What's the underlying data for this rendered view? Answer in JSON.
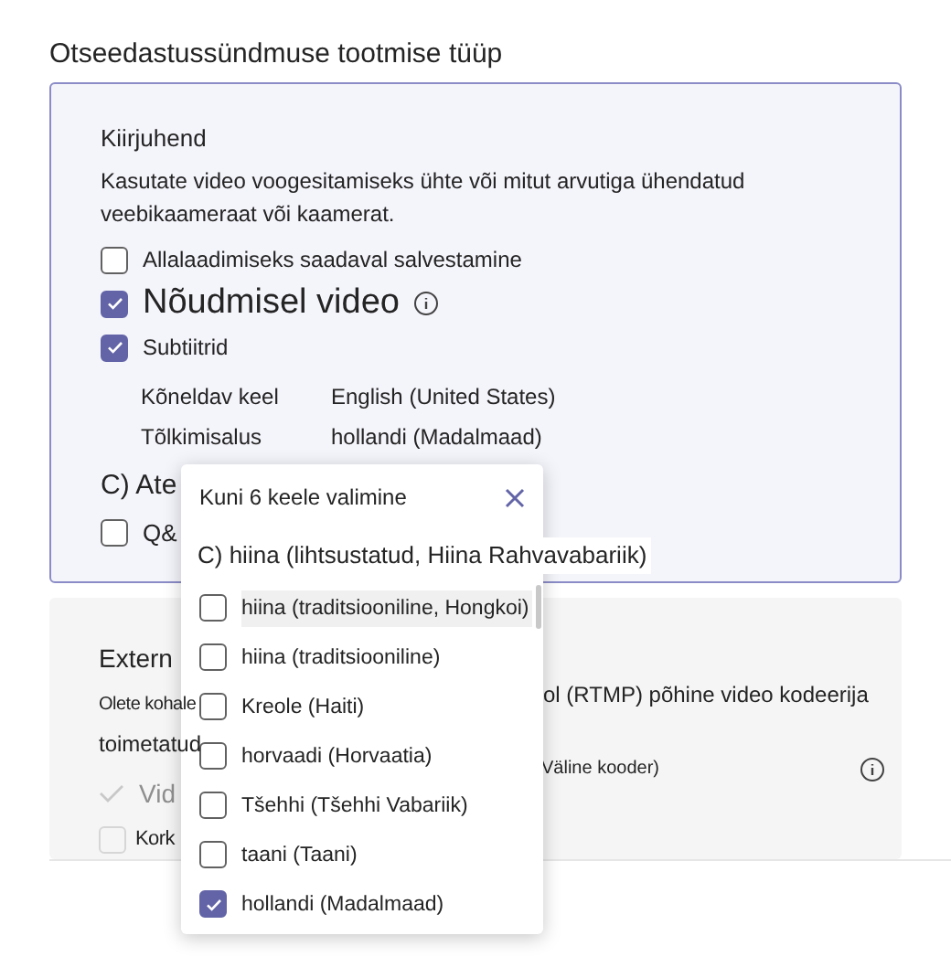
{
  "title": "Otseedastussündmuse tootmise tüüp",
  "quick_panel": {
    "heading": "Kiirjuhend",
    "description": "Kasutate video voogesitamiseks ühte või mitut arvutiga ühendatud veebikaameraat või kaamerat.",
    "options": [
      {
        "label": "Allalaadimiseks saadaval salvestamine",
        "checked": false,
        "large": false,
        "info": false
      },
      {
        "label": "Nõudmisel video",
        "checked": true,
        "large": true,
        "info": true
      },
      {
        "label": "Subtiitrid",
        "checked": true,
        "large": false,
        "info": false
      }
    ],
    "settings": [
      {
        "label": "Kõneldav keel",
        "value": "English (United States)"
      },
      {
        "label": "Tõlkimisalus",
        "value": "hollandi (Madalmaad)"
      }
    ],
    "section_label": "C) Ate",
    "extra_option": {
      "label": "Q&",
      "checked": false
    }
  },
  "external_panel": {
    "heading": "Extern",
    "description_start": "Olete kohale",
    "description_end": "ol (RTMP) põhine video kodeerija",
    "description_line2": "toimetatud",
    "video_label": "Vid",
    "encoder_label": "Väline kooder)",
    "option": {
      "label": "Kork",
      "checked": false
    }
  },
  "popup": {
    "title": "Kuni 6 keele valimine",
    "current": "C) hiina (lihtsustatud, Hiina Rahvavabariik)",
    "items": [
      {
        "label": "hiina (traditsiooniline, Hongkoi)",
        "checked": false,
        "hovered": true
      },
      {
        "label": "hiina (traditsiooniline)",
        "checked": false,
        "hovered": false
      },
      {
        "label": "Kreole (Haiti)",
        "checked": false,
        "hovered": false
      },
      {
        "label": "horvaadi (Horvaatia)",
        "checked": false,
        "hovered": false
      },
      {
        "label": "Tšehhi (Tšehhi Vabariik)",
        "checked": false,
        "hovered": false
      },
      {
        "label": "taani (Taani)",
        "checked": false,
        "hovered": false
      },
      {
        "label": "hollandi (Madalmaad)",
        "checked": true,
        "hovered": false
      }
    ]
  }
}
